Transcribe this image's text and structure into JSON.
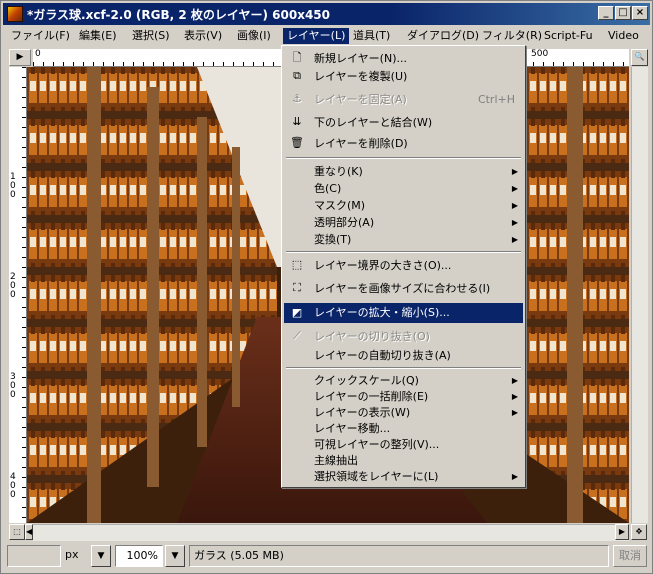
{
  "window": {
    "title": "*ガラス球.xcf-2.0 (RGB, 2 枚のレイヤー) 600x450",
    "minimize": "_",
    "maximize": "□",
    "close": "×"
  },
  "menubar": [
    "ファイル(F)",
    "編集(E)",
    "選択(S)",
    "表示(V)",
    "画像(I)",
    "レイヤー(L)",
    "道具(T)",
    "ダイアログ(D)",
    "フィルタ(R)",
    "Script-Fu",
    "Video"
  ],
  "ruler": {
    "h_ticks": [
      "0",
      "500"
    ],
    "v_ticks": [
      "1\n0\n0",
      "2\n0\n0",
      "3\n0\n0",
      "4\n0\n0"
    ]
  },
  "layer_menu": {
    "items": [
      {
        "label": "新規レイヤー(N)...",
        "icon": "new-layer-icon",
        "glyph": "🗋"
      },
      {
        "label": "レイヤーを複製(U)",
        "icon": "duplicate-layer-icon",
        "glyph": "⧉"
      },
      {
        "label": "レイヤーを固定(A)",
        "icon": "anchor-icon",
        "glyph": "⚓",
        "shortcut": "Ctrl+H",
        "disabled": true
      },
      {
        "label": "下のレイヤーと結合(W)",
        "icon": "merge-down-icon",
        "glyph": "⇊"
      },
      {
        "label": "レイヤーを削除(D)",
        "icon": "delete-layer-icon",
        "glyph": "🗑"
      },
      {
        "label": "重なり(K)",
        "submenu": true
      },
      {
        "label": "色(C)",
        "submenu": true
      },
      {
        "label": "マスク(M)",
        "submenu": true
      },
      {
        "label": "透明部分(A)",
        "submenu": true
      },
      {
        "label": "変換(T)",
        "submenu": true
      },
      {
        "label": "レイヤー境界の大きさ(O)...",
        "icon": "layer-boundary-icon",
        "glyph": "⬚"
      },
      {
        "label": "レイヤーを画像サイズに合わせる(I)",
        "icon": "layer-to-image-size-icon",
        "glyph": "⛶"
      },
      {
        "label": "レイヤーの拡大・縮小(S)...",
        "icon": "scale-layer-icon",
        "glyph": "◩",
        "highlighted": true
      },
      {
        "label": "レイヤーの切り抜き(O)",
        "icon": "crop-layer-icon",
        "glyph": "⟋",
        "disabled": true
      },
      {
        "label": "レイヤーの自動切り抜き(A)"
      },
      {
        "label": "クイックスケール(Q)",
        "submenu": true
      },
      {
        "label": "レイヤーの一括削除(E)",
        "submenu": true
      },
      {
        "label": "レイヤーの表示(W)",
        "submenu": true
      },
      {
        "label": "レイヤー移動..."
      },
      {
        "label": "可視レイヤーの整列(V)..."
      },
      {
        "label": "主線抽出"
      },
      {
        "label": "選択領域をレイヤーに(L)",
        "submenu": true
      }
    ]
  },
  "status": {
    "unit": "px",
    "zoom": "100%",
    "info": "ガラス (5.05 MB)",
    "cancel": "取消"
  },
  "colors": {
    "titlebar": "#0a246a",
    "highlight": "#0a246a",
    "face": "#d4d0c8"
  }
}
